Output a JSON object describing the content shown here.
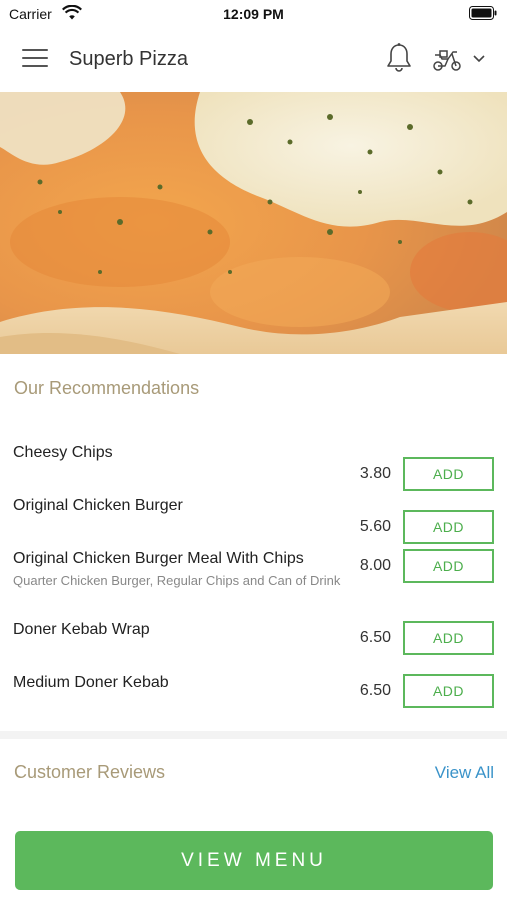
{
  "status_bar": {
    "carrier": "Carrier",
    "time": "12:09 PM"
  },
  "header": {
    "title": "Superb Pizza",
    "icons": [
      "menu-icon",
      "bell-icon",
      "scooter-icon",
      "chevron-down-icon"
    ]
  },
  "hero": {
    "icon": "pizza-photo",
    "colors": {
      "crust": "#e8b573",
      "cheese": "#f4ead0",
      "herbs": "#5b6b2a"
    }
  },
  "recommendations": {
    "heading": "Our Recommendations",
    "items": [
      {
        "name": "Cheesy Chips",
        "description": "",
        "price": "3.80",
        "button": "ADD"
      },
      {
        "name": "Original Chicken Burger",
        "description": "",
        "price": "5.60",
        "button": "ADD"
      },
      {
        "name": "Original Chicken Burger Meal With Chips",
        "description": "Quarter Chicken Burger, Regular Chips and Can of Drink",
        "price": "8.00",
        "button": "ADD"
      },
      {
        "name": "Doner Kebab Wrap",
        "description": "",
        "price": "6.50",
        "button": "ADD"
      },
      {
        "name": "Medium Doner Kebab",
        "description": "",
        "price": "6.50",
        "button": "ADD"
      }
    ]
  },
  "reviews": {
    "heading": "Customer Reviews",
    "view_all": "View All"
  },
  "footer": {
    "view_menu": "VIEW MENU"
  },
  "colors": {
    "accent_green": "#5cb85c",
    "heading_tan": "#a89a78",
    "link_blue": "#3a93c9"
  }
}
